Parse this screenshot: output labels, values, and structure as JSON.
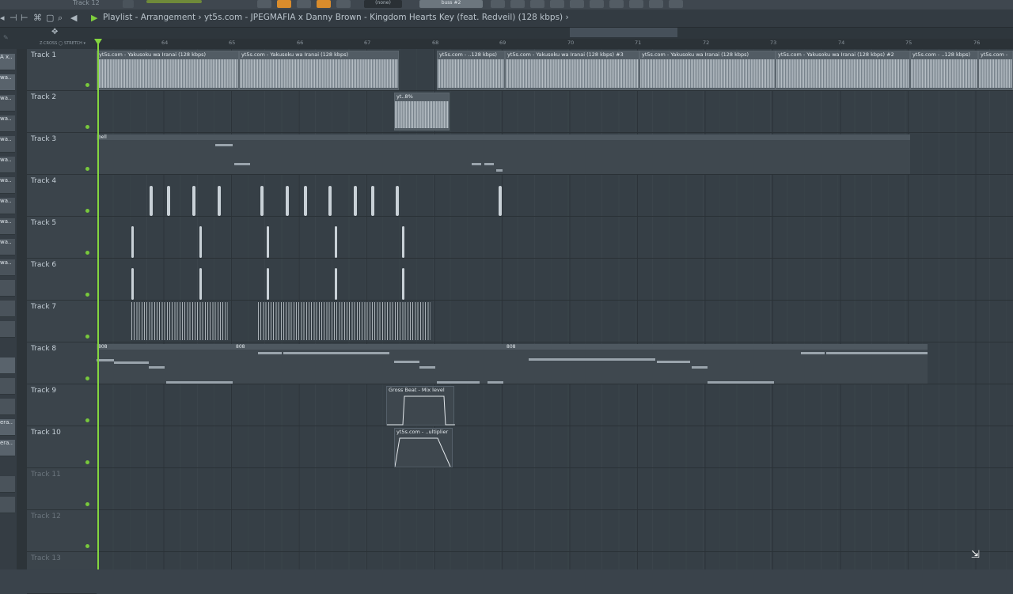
{
  "topbar": {
    "track_name": "Track 12",
    "mixer_label": "(none)",
    "bus_label": "buss #2"
  },
  "title": {
    "text": "Playlist - Arrangement › yt5s.com - JPEGMAFIA x Danny Brown - Kingdom Hearts Key (feat. Redveil) (128 kbps) ›"
  },
  "toolbar": {
    "stretch_label": "Z·CROSS ◯ STRETCH ▾"
  },
  "ruler": {
    "bars": [
      "64",
      "65",
      "66",
      "67",
      "68",
      "69",
      "70",
      "71",
      "72",
      "73",
      "74",
      "75",
      "76"
    ]
  },
  "patterns": [
    "A x..",
    "wa..",
    "wa..",
    "wa..",
    "wa..",
    "wa..",
    "wa..",
    "wa..",
    "wa..",
    "wa..",
    "wa..",
    "",
    "",
    "",
    "",
    "",
    "",
    "",
    "",
    "",
    "era..",
    "era.."
  ],
  "tracks": [
    {
      "label": "Track 1"
    },
    {
      "label": "Track 2"
    },
    {
      "label": "Track 3"
    },
    {
      "label": "Track 4"
    },
    {
      "label": "Track 5"
    },
    {
      "label": "Track 6"
    },
    {
      "label": "Track 7"
    },
    {
      "label": "Track 8"
    },
    {
      "label": "Track 9"
    },
    {
      "label": "Track 10"
    },
    {
      "label": "Track 11"
    },
    {
      "label": "Track 12"
    },
    {
      "label": "Track 13"
    }
  ],
  "clips": {
    "t1a": "yt5s.com - Yakusoku wa Iranai (128 kbps)",
    "t1b": "yt5s.com - Yakusoku wa Iranai (128 kbps)",
    "t1c": "yt5s.com - ..128 kbps)",
    "t1d": "yt5s.com - Yakusoku wa Iranai (128 kbps) #3",
    "t1e": "yt5s.com - Yakusoku wa Iranai (128 kbps)",
    "t1f": "yt5s.com - Yakusoku wa Iranai (128 kbps) #2",
    "t1g": "yt5s.com - ..128 kbps)",
    "t1h": "yt5s.com -",
    "t2": "yt..8%",
    "t3": "bell",
    "t8a": "808",
    "t8b": "808",
    "t8c": "808",
    "t9": "Gross Beat - Mix level",
    "t10": "yt5s.com - ..ultiplier"
  }
}
